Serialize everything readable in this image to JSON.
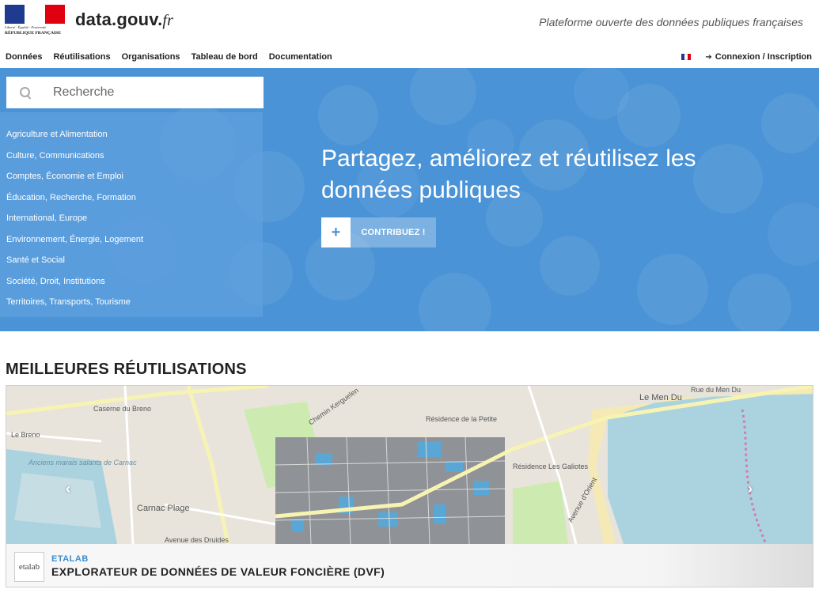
{
  "header": {
    "republique_devise": "Liberté · Égalité · Fraternité",
    "republique_label": "RÉPUBLIQUE FRANÇAISE",
    "brand": "data.gouv.",
    "brand_suffix": "fr",
    "tagline": "Plateforme ouverte des données publiques françaises"
  },
  "nav": {
    "items": [
      {
        "label": "Données"
      },
      {
        "label": "Réutilisations"
      },
      {
        "label": "Organisations"
      },
      {
        "label": "Tableau de bord"
      },
      {
        "label": "Documentation"
      }
    ],
    "login_label": "Connexion / Inscription",
    "flag_colors": [
      "#1f3b8f",
      "#ffffff",
      "#e1000f"
    ]
  },
  "hero": {
    "search_placeholder": "Recherche",
    "topics": [
      {
        "label": "Agriculture et Alimentation"
      },
      {
        "label": "Culture, Communications"
      },
      {
        "label": "Comptes, Économie et Emploi"
      },
      {
        "label": "Éducation, Recherche, Formation"
      },
      {
        "label": "International, Europe"
      },
      {
        "label": "Environnement, Énergie, Logement"
      },
      {
        "label": "Santé et Social"
      },
      {
        "label": "Société, Droit, Institutions"
      },
      {
        "label": "Territoires, Transports, Tourisme"
      }
    ],
    "headline": "Partagez, améliorez et réutilisez les données publiques",
    "contribute_plus": "+",
    "contribute_label": "CONTRIBUEZ !",
    "background_color": "#4a93d6"
  },
  "reuses": {
    "section_title": "MEILLEURES RÉUTILISATIONS",
    "card": {
      "org_logo_text": "etalab",
      "organization": "ETALAB",
      "title": "EXPLORATEUR DE DONNÉES DE VALEUR FONCIÈRE (DVF)",
      "prev_icon": "‹",
      "next_icon": "›",
      "map_labels": {
        "caserne": "Caserne du Breno",
        "breno": "Le Breno",
        "marais": "Anciens marais salants de Carnac",
        "plage": "Carnac Plage",
        "druides": "Avenue des Druides",
        "residence_petite": "Résidence de la Petite",
        "residence_galiotes": "Résidence Les Galiotes",
        "men_du": "Le Men Du",
        "rue_men_du": "Rue du Men Du",
        "av_orient": "Avenue d'Orient",
        "kerguelen": "Chemin Kerguelen"
      }
    }
  }
}
